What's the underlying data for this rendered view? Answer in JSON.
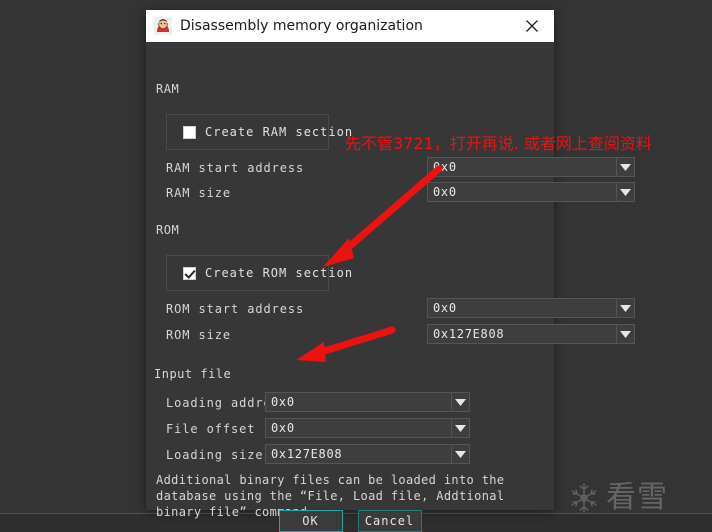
{
  "window": {
    "title": "Disassembly memory organization",
    "icon": "app-avatar-icon",
    "close_label": "✕"
  },
  "ram": {
    "group_label": "RAM",
    "checkbox_label": "Create RAM section",
    "checked": false,
    "fields": [
      {
        "label": "RAM start address",
        "value": "0x0"
      },
      {
        "label": "RAM size",
        "value": "0x0"
      }
    ]
  },
  "rom": {
    "group_label": "ROM",
    "checkbox_label": "Create ROM section",
    "checked": true,
    "fields": [
      {
        "label": "ROM start address",
        "value": "0x0"
      },
      {
        "label": "ROM size",
        "value": "0x127E808"
      }
    ]
  },
  "input_file": {
    "group_label": "Input file",
    "fields": [
      {
        "label": "Loading address",
        "value": "0x0"
      },
      {
        "label": "File offset",
        "value": "0x0"
      },
      {
        "label": "Loading size",
        "value": "0x127E808"
      }
    ]
  },
  "note": "Additional binary files can be loaded into the database using the “File, Load file, Addtional binary file” command.",
  "buttons": {
    "ok": "OK",
    "cancel": "Cancel"
  },
  "annotations": {
    "red_text": "先不管3721，打开再说. 或者网上查阅资料",
    "red_color": "#ee1111",
    "arrow_count": 2
  },
  "watermark": {
    "text": "看雪",
    "icon": "snowflake-icon"
  },
  "theme": {
    "dialog_bg": "#373737",
    "desktop_bg": "#343434",
    "titlebar_bg": "#ffffff",
    "accent": "#1fa8a0",
    "text": "#d6d6d6"
  }
}
